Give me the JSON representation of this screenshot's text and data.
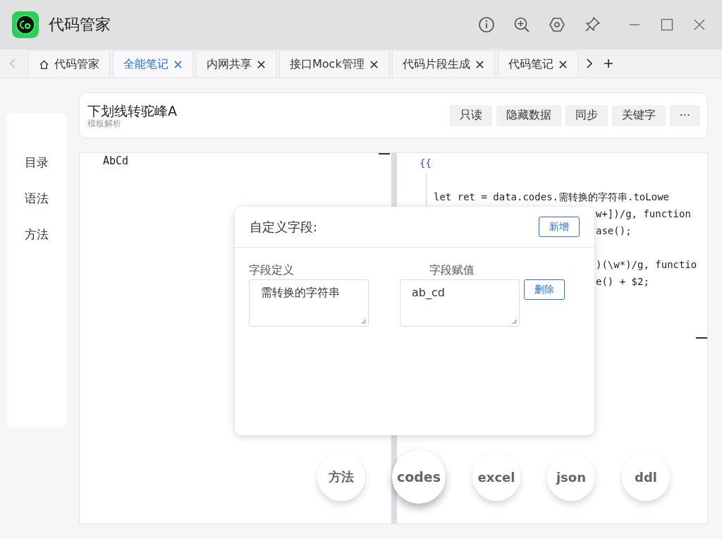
{
  "window": {
    "title": "代码管家"
  },
  "tabs": [
    {
      "label": "代码管家",
      "selected": false,
      "home": true,
      "closable": false
    },
    {
      "label": "全能笔记",
      "selected": true,
      "home": false,
      "closable": true
    },
    {
      "label": "内网共享",
      "selected": false,
      "home": false,
      "closable": true
    },
    {
      "label": "接口Mock管理",
      "selected": false,
      "home": false,
      "closable": true
    },
    {
      "label": "代码片段生成",
      "selected": false,
      "home": false,
      "closable": true
    },
    {
      "label": "代码笔记",
      "selected": false,
      "home": false,
      "closable": true
    }
  ],
  "sidebar": {
    "items": [
      "目录",
      "语法",
      "方法"
    ]
  },
  "header": {
    "title": "下划线转驼峰A",
    "subtitle": "模板解析",
    "buttons": [
      "只读",
      "隐藏数据",
      "同步",
      "关键字",
      "···"
    ]
  },
  "left_editor": {
    "lines": [
      "AbCd"
    ]
  },
  "right_editor": {
    "lines": [
      {
        "kind": "brace",
        "text": "{{"
      },
      {
        "kind": "blank"
      },
      {
        "kind": "full",
        "text": "let ret = data.codes.需转换的字符串.toLowe"
      },
      {
        "kind": "partial",
        "text": "w+])/g, function"
      },
      {
        "kind": "partial",
        "text": "ase();"
      },
      {
        "kind": "blank"
      },
      {
        "kind": "partial",
        "text": ")(\\w*)/g, functio"
      },
      {
        "kind": "partial",
        "text": "e() + $2;"
      }
    ]
  },
  "dialog": {
    "title": "自定义字段:",
    "add_button": "新增",
    "fields": [
      {
        "label": "字段定义",
        "value": "需转换的字符串"
      },
      {
        "label": "字段赋值",
        "value": "ab_cd"
      }
    ],
    "delete_button": "删除"
  },
  "fab_buttons": [
    {
      "label": "方法",
      "selected": false
    },
    {
      "label": "codes",
      "selected": true
    },
    {
      "label": "excel",
      "selected": false
    },
    {
      "label": "json",
      "selected": false
    },
    {
      "label": "ddl",
      "selected": false
    }
  ]
}
